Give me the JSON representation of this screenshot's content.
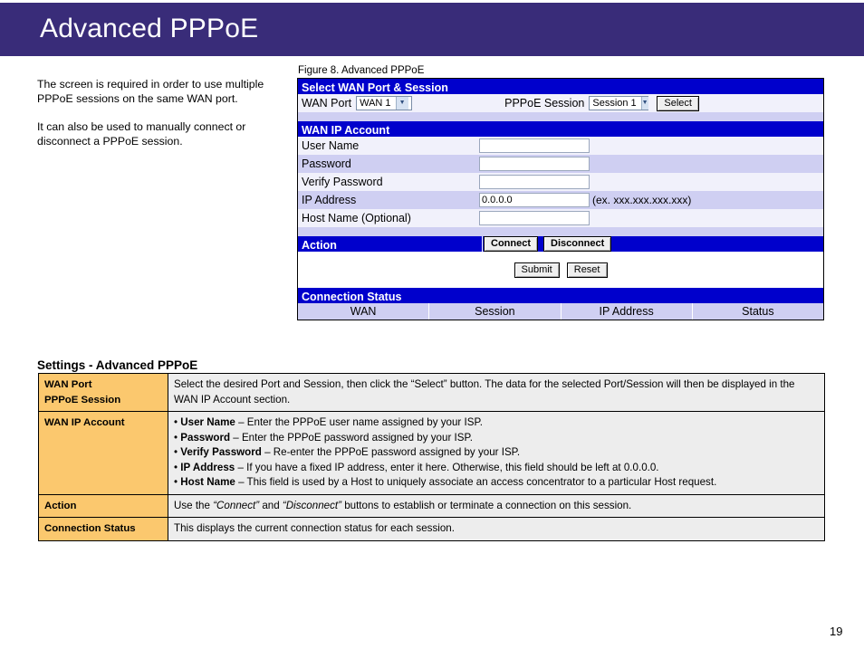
{
  "banner": {
    "title": "Advanced PPPoE"
  },
  "intro": {
    "paragraph1": "The screen is required in order to use multiple PPPoE sessions on the same WAN port.",
    "paragraph2": "It can also be used to manually connect or disconnect a PPPoE session."
  },
  "figure": {
    "caption": "Figure 8. Advanced PPPoE"
  },
  "router_ui": {
    "select_section": {
      "header": "Select WAN Port & Session",
      "wan_port_label": "WAN Port",
      "wan_port_value": "WAN 1",
      "pppoe_session_label": "PPPoE Session",
      "pppoe_session_value": "Session 1",
      "select_button": "Select"
    },
    "wan_ip_account": {
      "header": "WAN IP Account",
      "rows": [
        {
          "label": "User Name",
          "value": ""
        },
        {
          "label": "Password",
          "value": ""
        },
        {
          "label": "Verify Password",
          "value": ""
        },
        {
          "label": "IP Address",
          "value": "0.0.0.0",
          "hint": "(ex. xxx.xxx.xxx.xxx)"
        },
        {
          "label": "Host Name (Optional)",
          "value": ""
        }
      ]
    },
    "action": {
      "header": "Action",
      "connect_button": "Connect",
      "disconnect_button": "Disconnect",
      "submit_button": "Submit",
      "reset_button": "Reset"
    },
    "connection_status": {
      "header": "Connection Status",
      "columns": [
        "WAN",
        "Session",
        "IP Address",
        "Status"
      ]
    }
  },
  "settings": {
    "title": "Settings - Advanced PPPoE",
    "rows": [
      {
        "key": "WAN Port\nPPPoE Session",
        "key_line1": "WAN Port",
        "key_line2": "PPPoE Session",
        "description": "Select the desired Port and Session, then click the “Select” button. The data for the selected Port/Session will then be displayed in the WAN IP Account section."
      },
      {
        "key": "WAN IP Account",
        "bullets": [
          {
            "term": "User Name",
            "text": " – Enter the PPPoE user name assigned by your ISP."
          },
          {
            "term": "Password",
            "text": " – Enter the PPPoE password assigned by your ISP."
          },
          {
            "term": "Verify Password",
            "text": " – Re-enter the PPPoE password assigned by your ISP."
          },
          {
            "term": "IP Address",
            "text": " – If you have a fixed IP address, enter it here. Otherwise, this field should be left at 0.0.0.0."
          },
          {
            "term": "Host Name",
            "text": " – This field is used by a Host to uniquely associate an access concentrator to a particular Host request."
          }
        ]
      },
      {
        "key": "Action",
        "description_prefix": "Use the ",
        "quote1": "“Connect”",
        "description_mid": " and ",
        "quote2": "“Disconnect”",
        "description_suffix": " buttons to establish or terminate a connection on this session."
      },
      {
        "key": "Connection Status",
        "description": "This displays the current connection status for each session."
      }
    ]
  },
  "footer": {
    "page_number": "19"
  },
  "colors": {
    "banner_purple": "#392C79",
    "ui_blue": "#0000CC",
    "row_light": "#F1F1FB",
    "row_dark": "#CFCFF2",
    "key_orange": "#FBC86E",
    "desc_gray": "#EDEDED"
  }
}
